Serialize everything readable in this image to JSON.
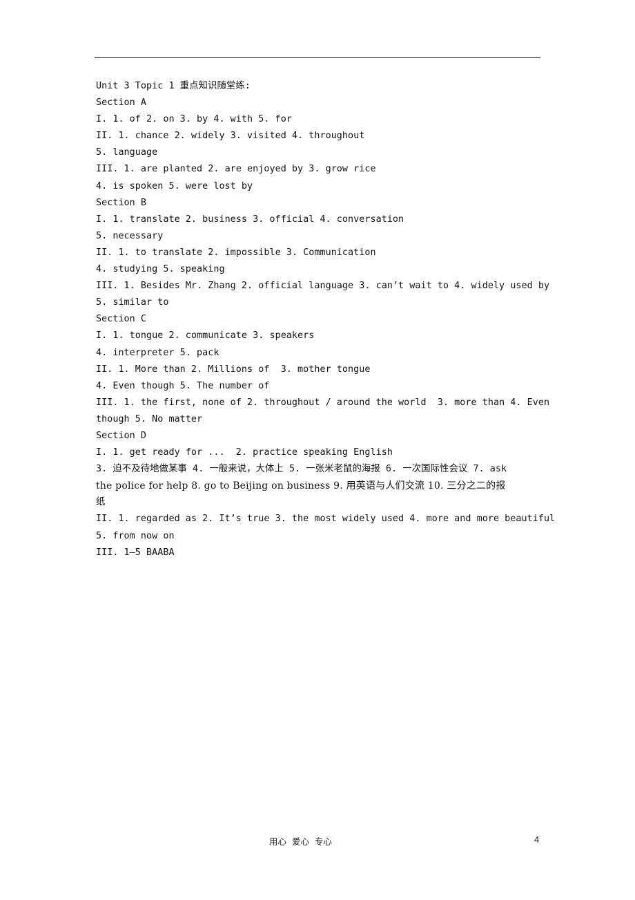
{
  "document": {
    "lines": [
      {
        "text": "Unit 3 Topic 1 重点知识随堂练:",
        "style": "mono"
      },
      {
        "text": "Section A",
        "style": "mono"
      },
      {
        "text": "I. 1. of 2. on 3. by 4. with 5. for",
        "style": "mono"
      },
      {
        "text": "II. 1. chance 2. widely 3. visited 4. throughout",
        "style": "mono"
      },
      {
        "text": "5. language",
        "style": "mono"
      },
      {
        "text": "III. 1. are planted 2. are enjoyed by 3. grow rice",
        "style": "mono"
      },
      {
        "text": "4. is spoken 5. were lost by",
        "style": "mono"
      },
      {
        "text": "Section B",
        "style": "mono"
      },
      {
        "text": "I. 1. translate 2. business 3. official 4. conversation",
        "style": "mono"
      },
      {
        "text": "5. necessary",
        "style": "mono"
      },
      {
        "text": "II. 1. to translate 2. impossible 3. Communication",
        "style": "mono"
      },
      {
        "text": "4. studying 5. speaking",
        "style": "mono"
      },
      {
        "text": "III. 1. Besides Mr. Zhang 2. official language 3. can’t wait to 4. widely used by",
        "style": "mono"
      },
      {
        "text": "5. similar to",
        "style": "mono"
      },
      {
        "text": "Section C",
        "style": "mono"
      },
      {
        "text": "I. 1. tongue 2. communicate 3. speakers",
        "style": "mono"
      },
      {
        "text": "4. interpreter 5. pack",
        "style": "mono"
      },
      {
        "text": "II. 1. More than 2. Millions of  3. mother tongue",
        "style": "mono"
      },
      {
        "text": "4. Even though 5. The number of",
        "style": "mono"
      },
      {
        "text": "III. 1. the first, none of 2. throughout / around the world  3. more than 4. Even",
        "style": "mono"
      },
      {
        "text": "though 5. No matter",
        "style": "mono"
      },
      {
        "text": "Section D",
        "style": "mono"
      },
      {
        "text": "I. 1. get ready for ...  2. practice speaking English",
        "style": "mono"
      },
      {
        "text": "3. 迫不及待地做某事 4. 一般来说，大体上 5. 一张米老鼠的海报 6. 一次国际性会议 7. ask",
        "style": "mono"
      },
      {
        "text": "the police for help 8. go to Beijing on business 9. 用英语与人们交流 10. 三分之二的报",
        "style": "prop"
      },
      {
        "text": "纸",
        "style": "mono"
      },
      {
        "text": "II. 1. regarded as 2. It’s true 3. the most widely used 4. more and more beautiful",
        "style": "mono"
      },
      {
        "text": "5. from now on",
        "style": "mono"
      },
      {
        "text": "III. 1—5 BAABA",
        "style": "mono"
      }
    ]
  },
  "footer": {
    "motto": "用心  爱心  专心",
    "page_number": "4"
  }
}
